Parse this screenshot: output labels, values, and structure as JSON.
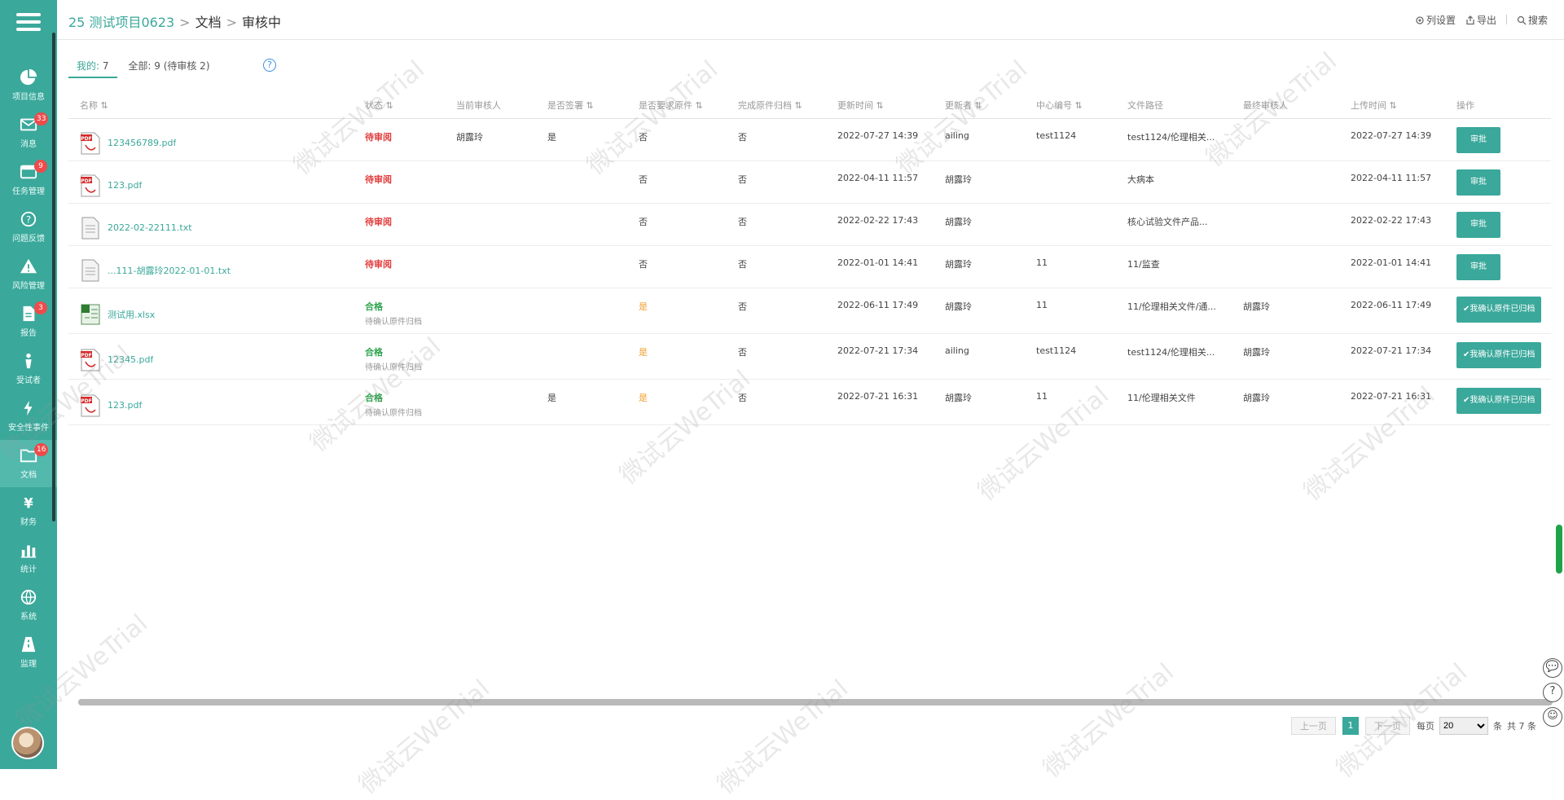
{
  "breadcrumb": {
    "project": "25 测试项目0623",
    "sep": ">",
    "section": "文档",
    "current": "审核中"
  },
  "top_actions": [
    {
      "name": "column-settings-action",
      "icon": "gear-icon",
      "label": "列设置"
    },
    {
      "name": "export-action",
      "icon": "export-icon",
      "label": "导出"
    },
    {
      "name": "search-action",
      "icon": "search-icon",
      "label": "搜索"
    }
  ],
  "sidebar": {
    "items": [
      {
        "name": "sidebar-item-project-info",
        "icon": "pie-chart-icon",
        "label": "项目信息",
        "badge": ""
      },
      {
        "name": "sidebar-item-messages",
        "icon": "mail-icon",
        "label": "消息",
        "badge": "33"
      },
      {
        "name": "sidebar-item-tasks",
        "icon": "tasks-icon",
        "label": "任务管理",
        "badge": "9"
      },
      {
        "name": "sidebar-item-issues",
        "icon": "question-icon",
        "label": "问题反馈",
        "badge": ""
      },
      {
        "name": "sidebar-item-risk",
        "icon": "warning-icon",
        "label": "风险管理",
        "badge": ""
      },
      {
        "name": "sidebar-item-reports",
        "icon": "report-icon",
        "label": "报告",
        "badge": "3"
      },
      {
        "name": "sidebar-item-subjects",
        "icon": "subject-icon",
        "label": "受试者",
        "badge": ""
      },
      {
        "name": "sidebar-item-safety",
        "icon": "lightning-icon",
        "label": "安全性事件",
        "badge": ""
      },
      {
        "name": "sidebar-item-docs",
        "icon": "folder-icon",
        "label": "文档",
        "badge": "16"
      },
      {
        "name": "sidebar-item-finance",
        "icon": "yen-icon",
        "label": "财务",
        "badge": ""
      },
      {
        "name": "sidebar-item-stats",
        "icon": "bar-chart-icon",
        "label": "统计",
        "badge": ""
      },
      {
        "name": "sidebar-item-settings",
        "icon": "globe-icon",
        "label": "系统",
        "badge": ""
      },
      {
        "name": "sidebar-item-supervise",
        "icon": "road-icon",
        "label": "监理",
        "badge": ""
      }
    ]
  },
  "tabs": [
    {
      "label_a": "我的:",
      "count": "7"
    },
    {
      "label_a": "全部:",
      "count": "9",
      "extra": "(待审核 2)"
    }
  ],
  "table": {
    "headers": [
      "名称",
      "状态",
      "当前审核人",
      "是否签署",
      "是否要求原件",
      "完成原件归档",
      "更新时间",
      "更新者",
      "中心编号",
      "文件路径",
      "最终审核人",
      "上传时间",
      "操作"
    ],
    "rows": [
      {
        "file": "123456789.pdf",
        "type": "pdf",
        "status": "待审阅",
        "sub": "",
        "color": "red",
        "curr": "胡露玲",
        "sign": "是",
        "req": "否",
        "arch": "否",
        "time": "2022-07-27 14:39",
        "reviewer": "ailing",
        "center": "test1124",
        "path": "test1124/伦理相关...",
        "final": "",
        "up": "2022-07-27 14:39",
        "op": "审批"
      },
      {
        "file": "123.pdf",
        "type": "pdf",
        "status": "待审阅",
        "sub": "",
        "color": "red",
        "curr": "",
        "sign": "",
        "req": "否",
        "arch": "否",
        "time": "2022-04-11 11:57",
        "reviewer": "胡露玲",
        "center": "",
        "path": "大病本",
        "final": "",
        "up": "2022-04-11 11:57",
        "op": "审批"
      },
      {
        "file": "2022-02-22111.txt",
        "type": "txt",
        "status": "待审阅",
        "sub": "",
        "color": "red",
        "curr": "",
        "sign": "",
        "req": "否",
        "arch": "否",
        "time": "2022-02-22 17:43",
        "reviewer": "胡露玲",
        "center": "",
        "path": "核心试验文件产品...",
        "final": "",
        "up": "2022-02-22 17:43",
        "op": "审批"
      },
      {
        "file": "...111-胡露玲2022-01-01.txt",
        "type": "txt",
        "status": "待审阅",
        "sub": "",
        "color": "red",
        "curr": "",
        "sign": "",
        "req": "否",
        "arch": "否",
        "time": "2022-01-01 14:41",
        "reviewer": "胡露玲",
        "center": "11",
        "path": "11/监查",
        "final": "",
        "up": "2022-01-01 14:41",
        "op": "审批"
      },
      {
        "file": "测试用.xlsx",
        "type": "xlsx",
        "status": "合格",
        "sub": "待确认原件归档",
        "color": "green",
        "curr": "",
        "sign": "",
        "req": "是",
        "arch": "否",
        "time": "2022-06-11 17:49",
        "reviewer": "胡露玲",
        "center": "11",
        "path": "11/伦理相关文件/通...",
        "final": "胡露玲",
        "up": "2022-06-11 17:49",
        "op": "✔我确认原件已归档"
      },
      {
        "file": "12345.pdf",
        "type": "pdf",
        "status": "合格",
        "sub": "待确认原件归档",
        "color": "green",
        "curr": "",
        "sign": "",
        "req": "是",
        "arch": "否",
        "time": "2022-07-21 17:34",
        "reviewer": "ailing",
        "center": "test1124",
        "path": "test1124/伦理相关...",
        "final": "胡露玲",
        "up": "2022-07-21 17:34",
        "op": "✔我确认原件已归档"
      },
      {
        "file": "123.pdf",
        "type": "pdf",
        "status": "合格",
        "sub": "待确认原件归档",
        "color": "green",
        "curr": "",
        "sign": "是",
        "req": "是",
        "arch": "否",
        "time": "2022-07-21 16:31",
        "reviewer": "胡露玲",
        "center": "11",
        "path": "11/伦理相关文件",
        "final": "胡露玲",
        "up": "2022-07-21 16:31",
        "op": "✔我确认原件已归档"
      }
    ]
  },
  "pager": {
    "prev": "上一页",
    "current": "1",
    "next": "下一页",
    "per_label": "每页",
    "size": "20",
    "unit": "条",
    "total": "共 7 条"
  },
  "hscroll": {
    "thumb_fraction": 1.0
  },
  "watermark": "微试云WeTrial",
  "float_buttons": [
    {
      "name": "chat-icon",
      "glyph": "💬"
    },
    {
      "name": "help-icon",
      "glyph": "?"
    },
    {
      "name": "service-icon",
      "glyph": "☺"
    }
  ]
}
